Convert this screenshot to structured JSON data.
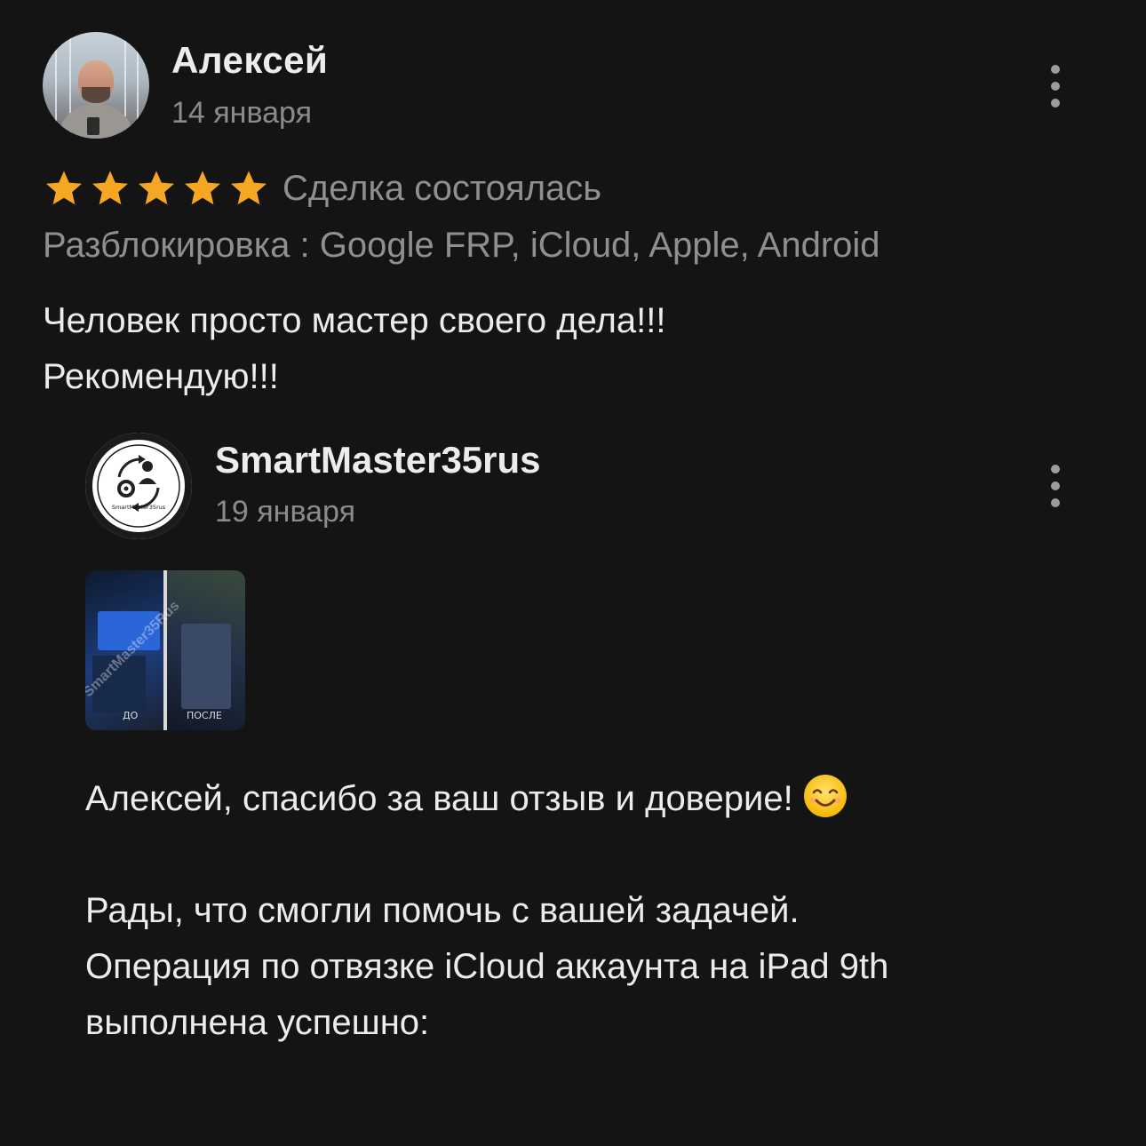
{
  "review": {
    "author_name": "Алексей",
    "date": "14 января",
    "rating": 5,
    "rating_max": 5,
    "star_color": "#f5a623",
    "deal_status": "Сделка состоялась",
    "service": "Разблокировка : Google FRP, iCloud, Apple, Android",
    "text_lines": [
      "Человек просто мастер своего дела!!!",
      "Рекомендую!!!"
    ]
  },
  "reply": {
    "seller_name": "SmartMaster35rus",
    "avatar_label": "SmartMaster35rus",
    "date": "19 января",
    "photo": {
      "watermark": "SmartMaster35Rus",
      "before_label": "ДО",
      "after_label": "ПОСЛЕ"
    },
    "greeting": "Алексей, спасибо за ваш отзыв и доверие!",
    "greeting_emoji": "smiling-face-icon",
    "body_lines": [
      "Рады, что смогли помочь с вашей задачей.",
      "Операция по отвязке iCloud аккаунта на iPad 9th",
      "выполнена успешно:"
    ]
  }
}
